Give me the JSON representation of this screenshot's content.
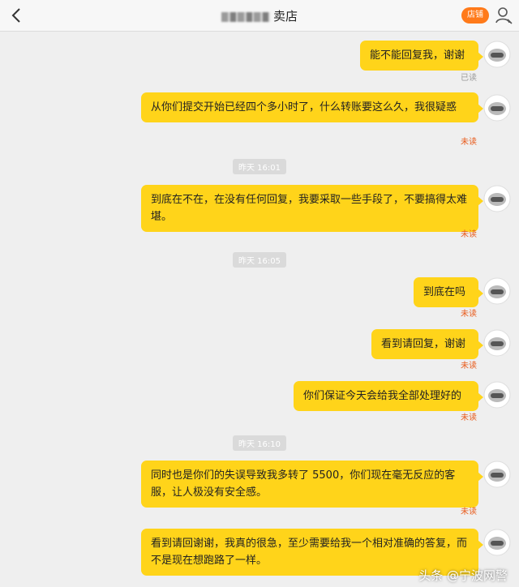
{
  "header": {
    "title_suffix": "卖店",
    "shop_button": "店铺",
    "back_icon": "chevron-left-icon",
    "user_icon": "person-icon"
  },
  "colors": {
    "bubble": "#ffd41a",
    "unread": "#e85a1a",
    "shop_button": "#ff7a1a"
  },
  "messages": [
    {
      "text": "能不能回复我，谢谢",
      "status": "已读"
    },
    {
      "text": "从你们提交开始已经四个多小时了，什么转账要这么久，我很疑惑",
      "status": "未读"
    },
    {
      "text": "到底在不在，在没有任何回复，我要采取一些手段了，不要搞得太难堪。",
      "status": "未读"
    },
    {
      "text": "到底在吗",
      "status": "未读"
    },
    {
      "text": "看到请回复，谢谢",
      "status": "未读"
    },
    {
      "text": "你们保证今天会给我全部处理好的",
      "status": "未读"
    },
    {
      "text": "同时也是你们的失误导致我多转了 5500，你们现在毫无反应的客服，让人极没有安全感。",
      "status": "未读"
    },
    {
      "text": "看到请回谢谢，我真的很急，至少需要给我一个相对准确的答复，而不是现在想跑路了一样。",
      "status": ""
    }
  ],
  "timestamps": [
    "昨天 16:01",
    "昨天 16:05",
    "昨天 16:10"
  ],
  "watermark": "头条 @宁波网警"
}
